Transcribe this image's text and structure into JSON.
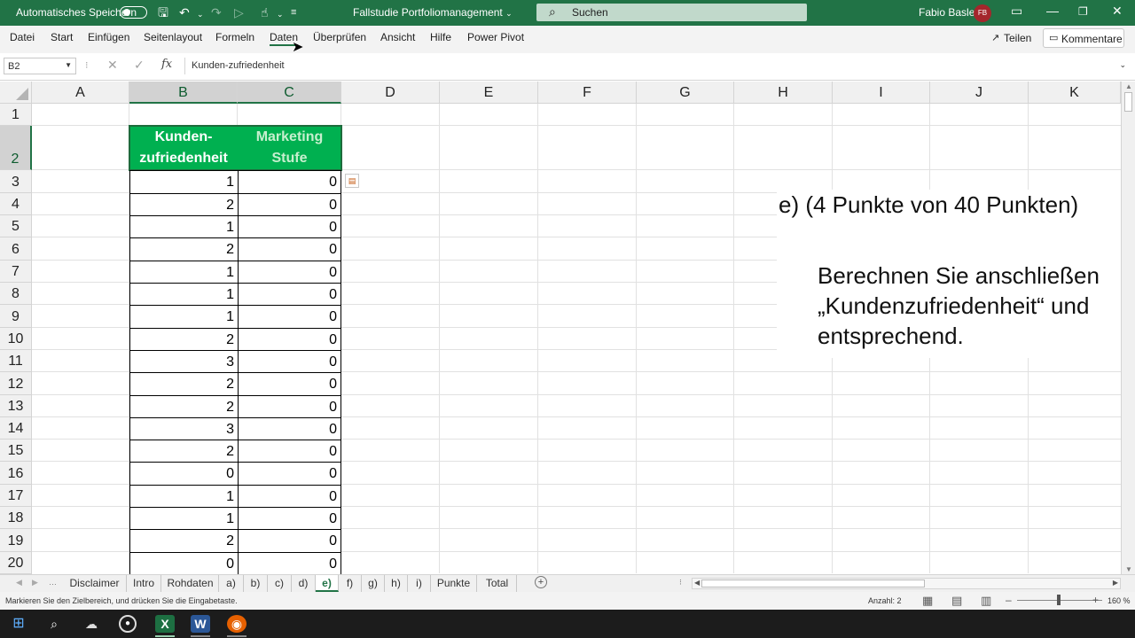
{
  "titlebar": {
    "autosave_label": "Automatisches Speichern",
    "doc_title": "Fallstudie Portfoliomanagement",
    "doc_title_caret": "⌄",
    "search_placeholder": "Suchen",
    "user_name": "Fabio Basler",
    "user_initials": "FB"
  },
  "menu": {
    "items": [
      "Datei",
      "Start",
      "Einfügen",
      "Seitenlayout",
      "Formeln",
      "Daten",
      "Überprüfen",
      "Ansicht",
      "Hilfe",
      "Power Pivot"
    ],
    "active": "Daten",
    "share_label": "Teilen",
    "comments_label": "Kommentare"
  },
  "formula_bar": {
    "name_box": "B2",
    "formula": "Kunden-zufriedenheit",
    "fx_label": "fx"
  },
  "grid": {
    "columns": [
      "A",
      "B",
      "C",
      "D",
      "E",
      "F",
      "G",
      "H",
      "I",
      "J",
      "K"
    ],
    "selected_columns": [
      "B",
      "C"
    ],
    "rows": [
      "1",
      "2",
      "3",
      "4",
      "5",
      "6",
      "7",
      "8",
      "9",
      "10",
      "11",
      "12",
      "13",
      "14",
      "15",
      "16",
      "17",
      "18",
      "19",
      "20"
    ],
    "selected_row": "2",
    "header_b_line1": "Kunden-",
    "header_b_line2": "zufriedenheit",
    "header_c_line1": "Marketing",
    "header_c_line2": "Stufe",
    "col_b_values": [
      "1",
      "2",
      "1",
      "2",
      "1",
      "1",
      "1",
      "2",
      "3",
      "2",
      "2",
      "3",
      "2",
      "0",
      "1",
      "1",
      "2",
      "0"
    ],
    "col_c_values": [
      "0",
      "0",
      "0",
      "0",
      "0",
      "0",
      "0",
      "0",
      "0",
      "0",
      "0",
      "0",
      "0",
      "0",
      "0",
      "0",
      "0",
      "0"
    ]
  },
  "task": {
    "head": "e)  (4 Punkte von 40 Punkten)",
    "line1": "Berechnen Sie anschließen",
    "line2": "„Kundenzufriedenheit“ und",
    "line3": "entsprechend."
  },
  "sheets": {
    "tabs": [
      "Disclaimer",
      "Intro",
      "Rohdaten",
      "a)",
      "b)",
      "c)",
      "d)",
      "e)",
      "f)",
      "g)",
      "h)",
      "i)",
      "Punkte",
      "Total"
    ],
    "active": "e)"
  },
  "status": {
    "message": "Markieren Sie den Zielbereich, und drücken Sie die Eingabetaste.",
    "count": "Anzahl: 2",
    "zoom": "160 %"
  },
  "colors": {
    "excel_green": "#217346",
    "header_fill": "#00b050"
  }
}
